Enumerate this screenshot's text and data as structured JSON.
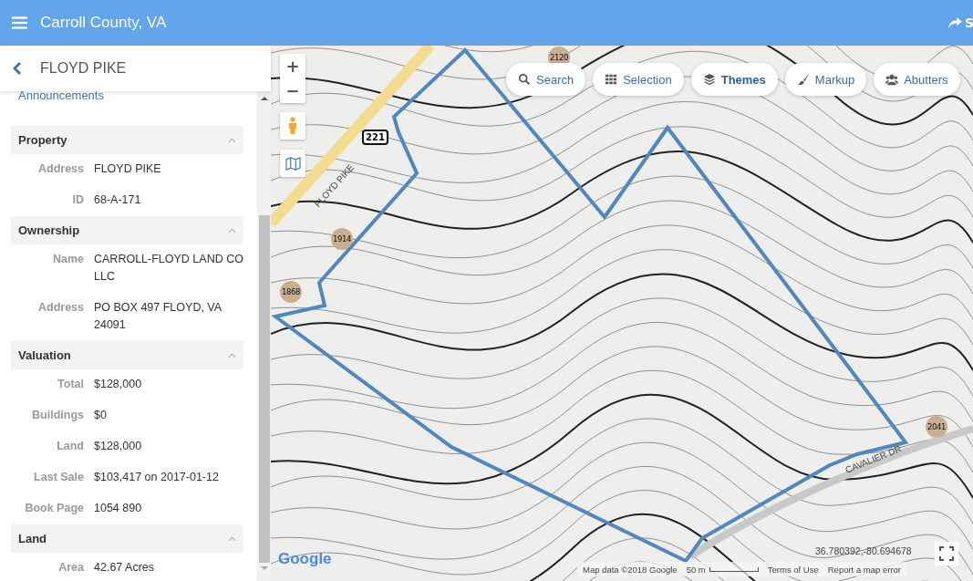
{
  "header": {
    "title": "Carroll County, VA",
    "share_label": "S"
  },
  "panel": {
    "title": "FLOYD PIKE",
    "link": "Announcements",
    "sections": [
      {
        "title": "Property",
        "expanded": true,
        "rows": [
          {
            "label": "Address",
            "value": "FLOYD PIKE"
          },
          {
            "label": "ID",
            "value": "68-A-171"
          }
        ]
      },
      {
        "title": "Ownership",
        "expanded": true,
        "rows": [
          {
            "label": "Name",
            "value": "CARROLL-FLOYD LAND CO LLC"
          },
          {
            "label": "Address",
            "value": "PO BOX 497 FLOYD, VA 24091"
          }
        ]
      },
      {
        "title": "Valuation",
        "expanded": true,
        "rows": [
          {
            "label": "Total",
            "value": "$128,000"
          },
          {
            "label": "Buildings",
            "value": "$0"
          },
          {
            "label": "Land",
            "value": "$128,000"
          },
          {
            "label": "Last Sale",
            "value": "$103,417 on 2017-01-12"
          },
          {
            "label": "Book Page",
            "value": "1054 890"
          }
        ]
      },
      {
        "title": "Land",
        "expanded": true,
        "rows": [
          {
            "label": "Area",
            "value": "42.67 Acres"
          }
        ]
      }
    ]
  },
  "map": {
    "zoom_in": "+",
    "zoom_out": "−",
    "tools": [
      {
        "kind": "search",
        "label": "Search",
        "selected": false
      },
      {
        "kind": "grid",
        "label": "Selection",
        "selected": false
      },
      {
        "kind": "layers",
        "label": "Themes",
        "selected": true
      },
      {
        "kind": "brush",
        "label": "Markup",
        "selected": false
      },
      {
        "kind": "users",
        "label": "Abutters",
        "selected": false
      }
    ],
    "roads": [
      {
        "label": "FLOYD PIKE",
        "kind": "pike"
      },
      {
        "label": "CAVALIER DR",
        "kind": "drive"
      }
    ],
    "shield": "221",
    "markers": [
      "2120",
      "1914",
      "1868",
      "2041"
    ],
    "google": "Google",
    "coordinates": "36.780392,-80.694678",
    "attribution": "Map data ©2018 Google",
    "scale": "50 m",
    "terms": "Terms of Use",
    "report": "Report a map error"
  }
}
